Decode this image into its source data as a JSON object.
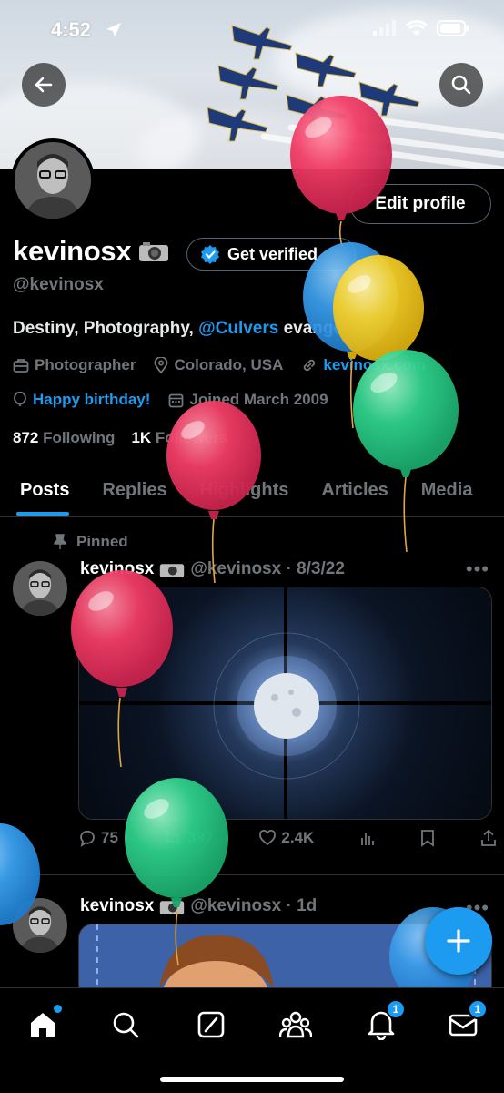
{
  "status_bar": {
    "time": "4:52"
  },
  "profile": {
    "name": "kevinosx",
    "handle": "@kevinosx",
    "edit_profile_label": "Edit profile",
    "get_verified_label": "Get verified",
    "bio_prefix": "Destiny, Photography, ",
    "bio_mention": "@Culvers",
    "bio_suffix": " evangelist.",
    "profession": "Photographer",
    "location": "Colorado, USA",
    "website": "kevinosx.com",
    "birthday": "Happy birthday!",
    "joined": "Joined March 2009",
    "following_count": "872",
    "following_label": "Following",
    "followers_count": "1K",
    "followers_label": "Followers"
  },
  "tabs": [
    {
      "label": "Posts",
      "active": true
    },
    {
      "label": "Replies"
    },
    {
      "label": "Highlights"
    },
    {
      "label": "Articles"
    },
    {
      "label": "Media"
    }
  ],
  "posts": [
    {
      "pinned_label": "Pinned",
      "author": "kevinosx",
      "handle_date": "@kevinosx · 8/3/22",
      "replies": "75",
      "reposts": "397",
      "likes": "2.4K"
    },
    {
      "author": "kevinosx",
      "handle_date": "@kevinosx · 1d"
    }
  ],
  "nav": {
    "notifications_badge": "1",
    "messages_badge": "1"
  },
  "colors": {
    "accent": "#1d9bf0",
    "background": "#000000",
    "muted": "#71767b"
  },
  "icons": [
    "back-arrow-icon",
    "search-icon",
    "camera-emoji-icon",
    "verified-badge-icon",
    "briefcase-icon",
    "location-pin-icon",
    "link-icon",
    "balloon-icon",
    "calendar-icon",
    "pin-icon",
    "reply-icon",
    "repost-icon",
    "like-icon",
    "views-icon",
    "bookmark-icon",
    "share-icon",
    "plus-icon",
    "home-icon",
    "grok-icon",
    "communities-icon",
    "bell-icon",
    "mail-icon"
  ]
}
